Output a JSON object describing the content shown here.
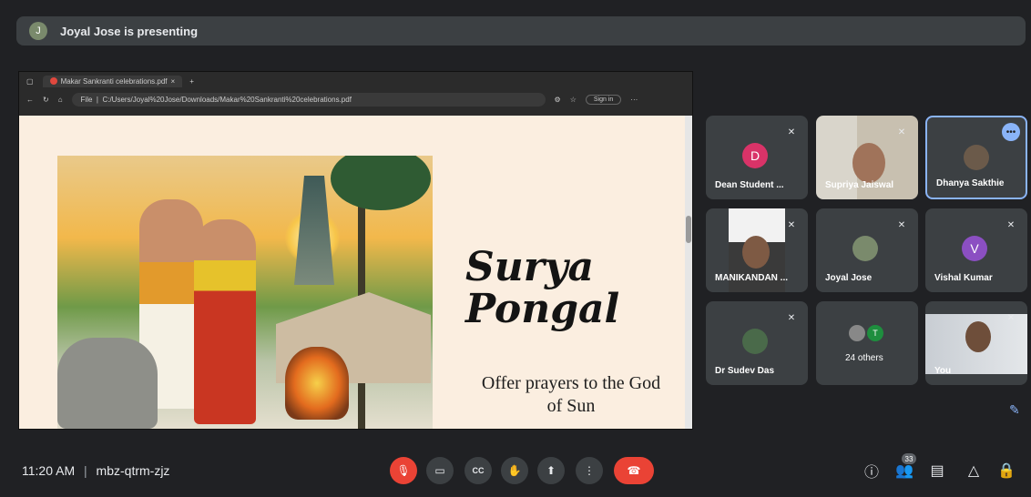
{
  "banner": {
    "text": "Joyal Jose is presenting"
  },
  "browser": {
    "tab_title": "Makar Sankranti celebrations.pdf",
    "file_label": "File",
    "url": "C:/Users/Joyal%20Jose/Downloads/Makar%20Sankranti%20celebrations.pdf",
    "signin_label": "Sign in"
  },
  "slide": {
    "title_line1": "Surya",
    "title_line2": "Pongal",
    "subtitle_line1": "Offer prayers to the God",
    "subtitle_line2": "of Sun"
  },
  "participants": [
    {
      "name": "Dean Student ...",
      "initial": "D",
      "color": "#d93368"
    },
    {
      "name": "Supriya Jaiswal"
    },
    {
      "name": "Dhanya Sakthie",
      "more": "•••"
    },
    {
      "name": "MANIKANDAN ..."
    },
    {
      "name": "Joyal Jose"
    },
    {
      "name": "Vishal Kumar",
      "initial": "V",
      "color": "#8b4fc2"
    },
    {
      "name": "Dr Sudev Das"
    },
    {
      "name": "24 others",
      "initial": "T",
      "color": "#1e8e3e"
    },
    {
      "name": "You"
    }
  ],
  "footer": {
    "time": "11:20 AM",
    "separator": "|",
    "meeting_code": "mbz-qtrm-zjz",
    "people_count": "33"
  },
  "icons": {
    "mic_off": "🎙",
    "camera": "▭",
    "cc": "CC",
    "hand": "✋",
    "present": "⬆",
    "more": "⋮",
    "end": "☎",
    "info": "ⓘ",
    "people": "👥",
    "chat": "▤",
    "activities": "△",
    "lock": "🔒"
  }
}
